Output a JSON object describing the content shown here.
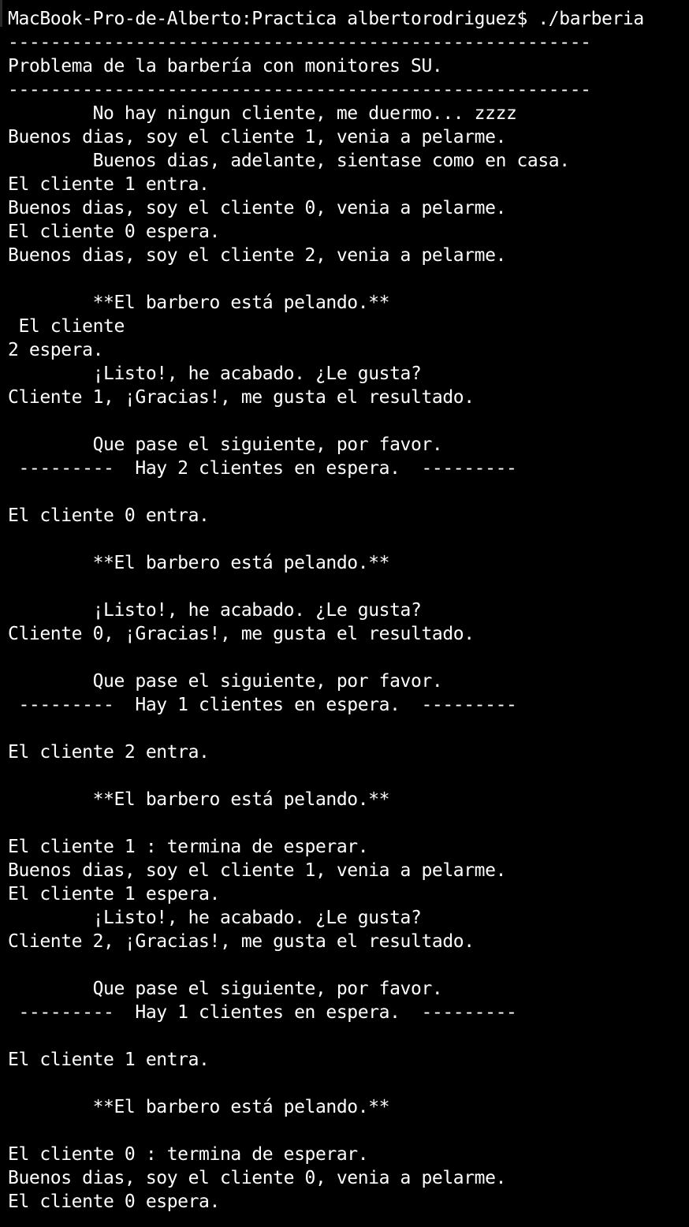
{
  "colors": {
    "background": "#000000",
    "text": "#ffffff"
  },
  "terminal": {
    "prompt": "MacBook-Pro-de-Alberto:Practica albertorodriguez$ ./barberia",
    "lines": [
      "-------------------------------------------------------",
      "Problema de la barbería con monitores SU.",
      "-------------------------------------------------------",
      "\tNo hay ningun cliente, me duermo... zzzz",
      "Buenos dias, soy el cliente 1, venia a pelarme.",
      "\tBuenos dias, adelante, sientase como en casa.",
      "El cliente 1 entra.",
      "Buenos dias, soy el cliente 0, venia a pelarme.",
      "El cliente 0 espera.",
      "Buenos dias, soy el cliente 2, venia a pelarme.",
      "",
      "\t**El barbero está pelando.**",
      " El cliente",
      "2 espera.",
      "\t¡Listo!, he acabado. ¿Le gusta?",
      "Cliente 1, ¡Gracias!, me gusta el resultado.",
      "",
      "\tQue pase el siguiente, por favor.",
      " ---------  Hay 2 clientes en espera.  ---------",
      "",
      "El cliente 0 entra.",
      "",
      "\t**El barbero está pelando.**",
      "",
      "\t¡Listo!, he acabado. ¿Le gusta?",
      "Cliente 0, ¡Gracias!, me gusta el resultado.",
      "",
      "\tQue pase el siguiente, por favor.",
      " ---------  Hay 1 clientes en espera.  ---------",
      "",
      "El cliente 2 entra.",
      "",
      "\t**El barbero está pelando.**",
      "",
      "El cliente 1 : termina de esperar.",
      "Buenos dias, soy el cliente 1, venia a pelarme.",
      "El cliente 1 espera.",
      "\t¡Listo!, he acabado. ¿Le gusta?",
      "Cliente 2, ¡Gracias!, me gusta el resultado.",
      "",
      "\tQue pase el siguiente, por favor.",
      " ---------  Hay 1 clientes en espera.  ---------",
      "",
      "El cliente 1 entra.",
      "",
      "\t**El barbero está pelando.**",
      "",
      "El cliente 0 : termina de esperar.",
      "Buenos dias, soy el cliente 0, venia a pelarme.",
      "El cliente 0 espera."
    ]
  }
}
